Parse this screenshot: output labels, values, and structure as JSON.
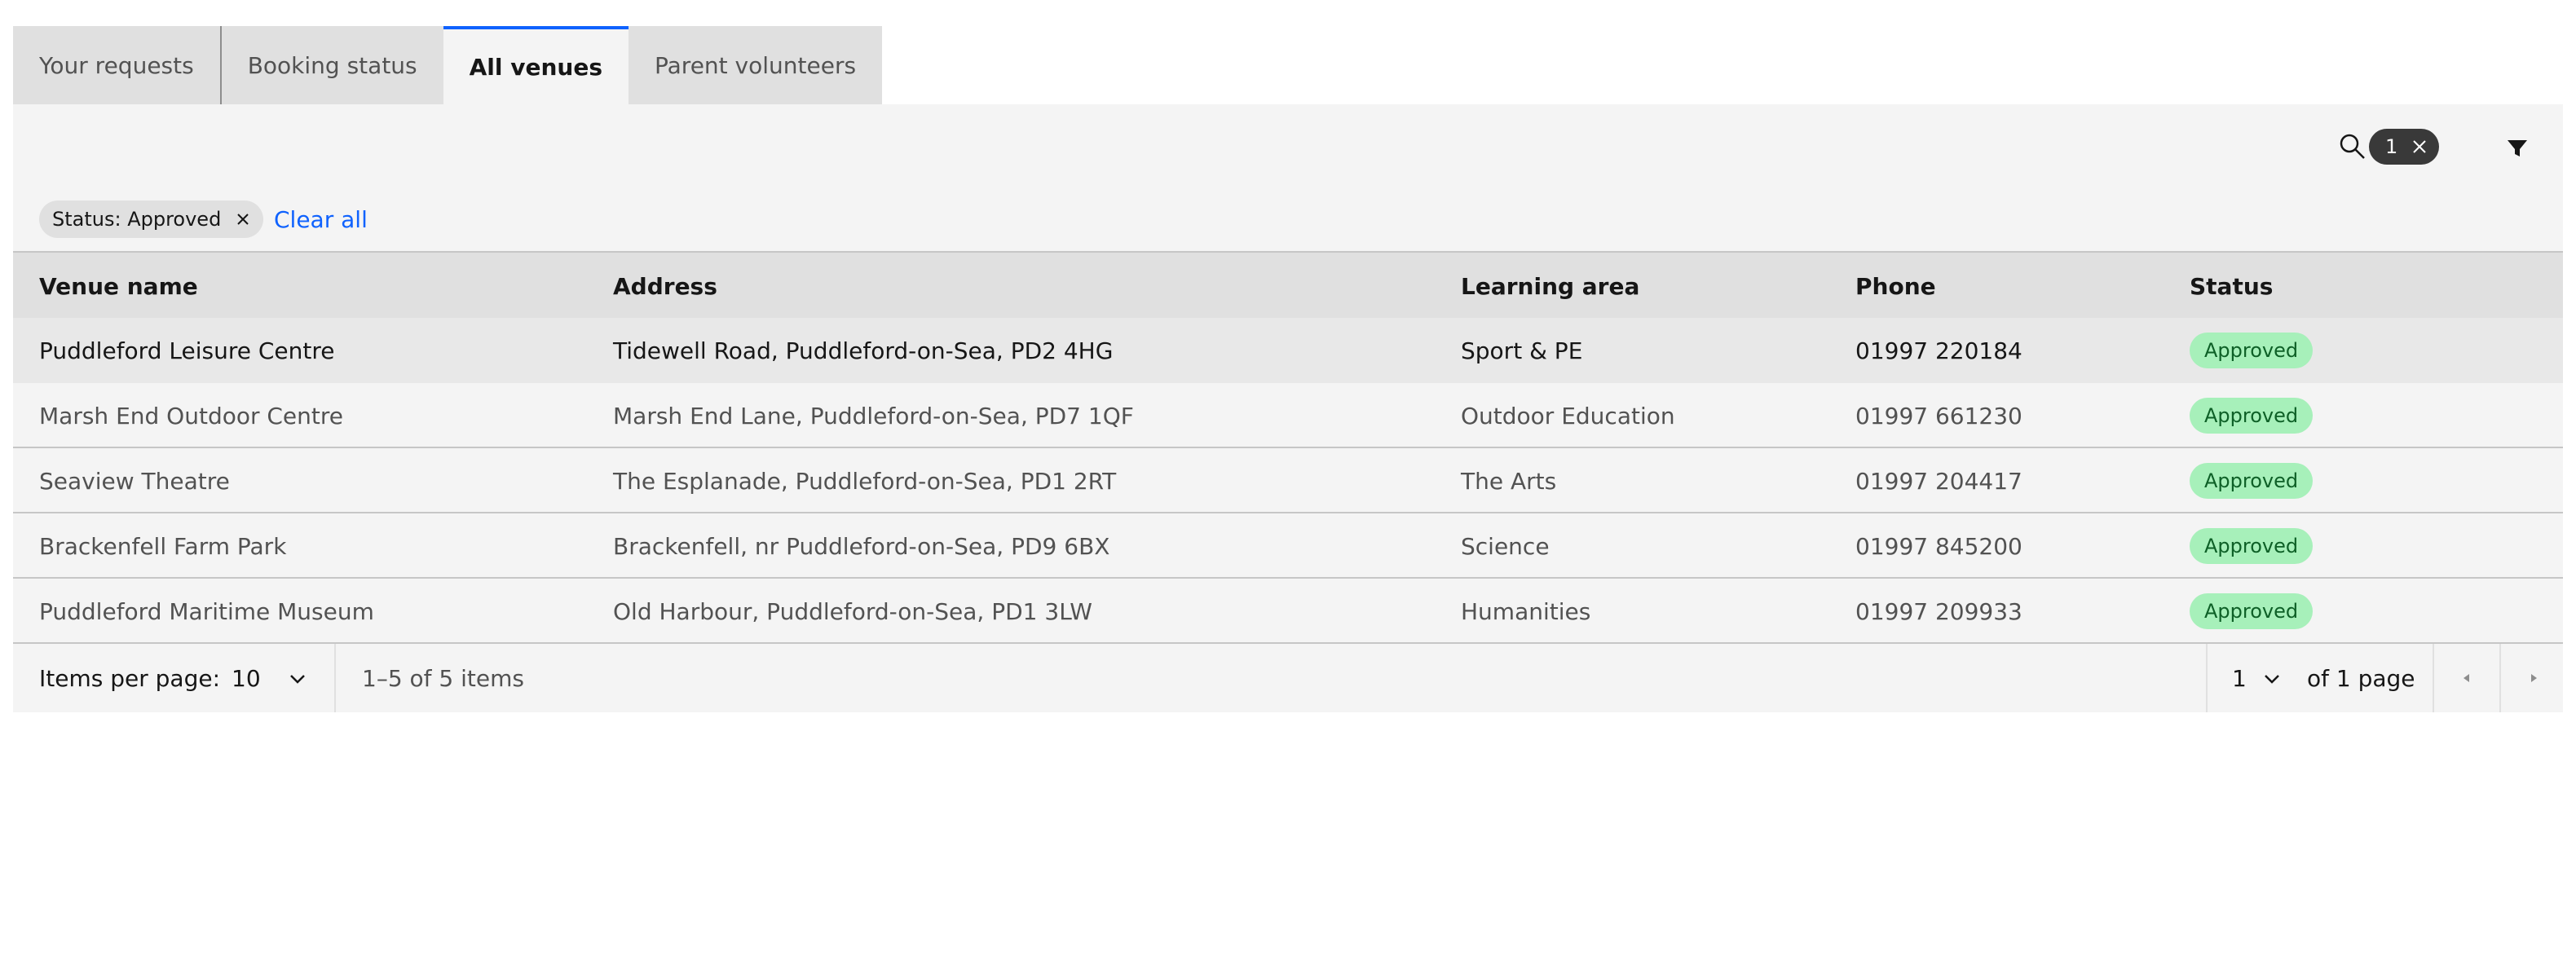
{
  "tabs": [
    {
      "label": "Your requests"
    },
    {
      "label": "Booking status"
    },
    {
      "label": "All venues",
      "active": true
    },
    {
      "label": "Parent volunteers"
    }
  ],
  "toolbar": {
    "search_icon": "search-icon",
    "active_filter_count": "1",
    "filter_icon": "filter-icon"
  },
  "filters": {
    "chip_label": "Status: Approved",
    "clear_all": "Clear all"
  },
  "table": {
    "columns": [
      "Venue name",
      "Address",
      "Learning area",
      "Phone",
      "Status"
    ],
    "rows": [
      {
        "name": "Puddleford Leisure Centre",
        "address": "Tidewell Road, Puddleford-on-Sea, PD2 4HG",
        "area": "Sport & PE",
        "phone": "01997 220184",
        "status": "Approved"
      },
      {
        "name": "Marsh End Outdoor Centre",
        "address": "Marsh End Lane, Puddleford-on-Sea, PD7 1QF",
        "area": "Outdoor Education",
        "phone": "01997 661230",
        "status": "Approved"
      },
      {
        "name": "Seaview Theatre",
        "address": "The Esplanade, Puddleford-on-Sea, PD1 2RT",
        "area": "The Arts",
        "phone": "01997 204417",
        "status": "Approved"
      },
      {
        "name": "Brackenfell Farm Park",
        "address": "Brackenfell, nr Puddleford-on-Sea, PD9 6BX",
        "area": "Science",
        "phone": "01997 845200",
        "status": "Approved"
      },
      {
        "name": "Puddleford Maritime Museum",
        "address": "Old Harbour, Puddleford-on-Sea, PD1 3LW",
        "area": "Humanities",
        "phone": "01997 209933",
        "status": "Approved"
      }
    ]
  },
  "pagination": {
    "items_per_page_label": "Items per page:",
    "items_per_page": "10",
    "range": "1–5 of 5 items",
    "page": "1",
    "of_pages": "of 1 page"
  },
  "colors": {
    "accent": "#0f62fe",
    "approved_bg": "#a7f0ba",
    "approved_text": "#0e6027"
  }
}
